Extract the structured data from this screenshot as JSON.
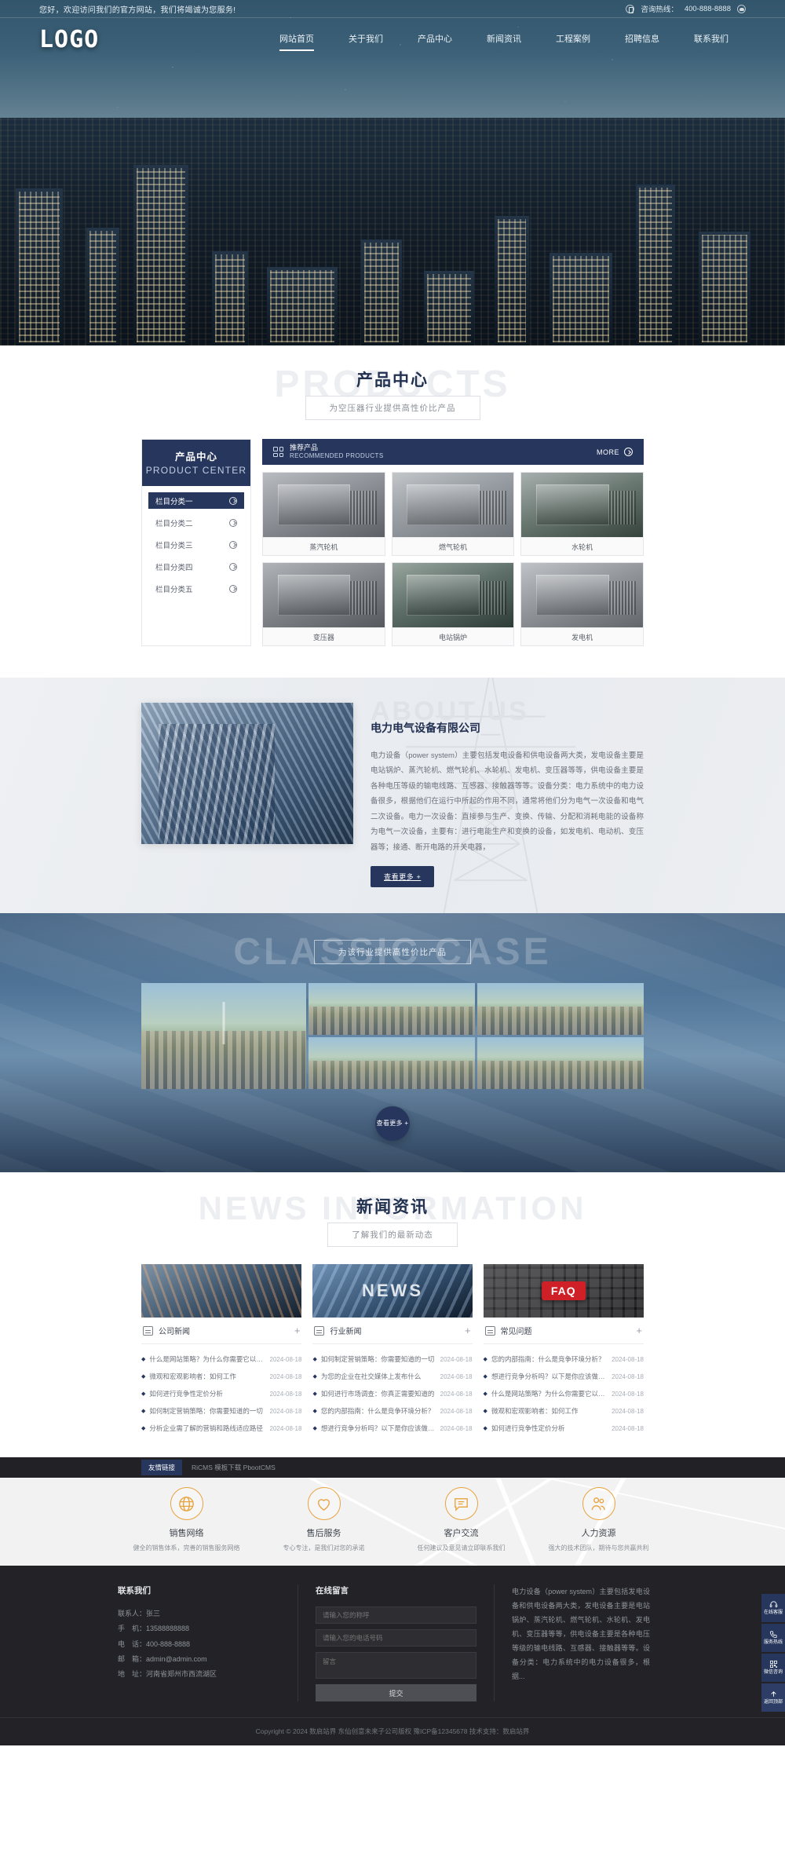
{
  "topbar": {
    "welcome": "您好，欢迎访问我们的官方网站，我们将竭诚为您服务!",
    "hotline_label": "咨询热线：",
    "hotline_number": "400-888-8888"
  },
  "header": {
    "logo": "LOGO",
    "nav": [
      {
        "label": "网站首页",
        "active": true
      },
      {
        "label": "关于我们",
        "active": false
      },
      {
        "label": "产品中心",
        "active": false
      },
      {
        "label": "新闻资讯",
        "active": false
      },
      {
        "label": "工程案例",
        "active": false
      },
      {
        "label": "招聘信息",
        "active": false
      },
      {
        "label": "联系我们",
        "active": false
      }
    ]
  },
  "products": {
    "ghost": "PRODUCTS",
    "title": "产品中心",
    "subtitle": "为空压器行业提供高性价比产品",
    "sidebar": {
      "title_cn": "产品中心",
      "title_en": "PRODUCT CENTER",
      "items": [
        {
          "label": "栏目分类一",
          "active": true
        },
        {
          "label": "栏目分类二",
          "active": false
        },
        {
          "label": "栏目分类三",
          "active": false
        },
        {
          "label": "栏目分类四",
          "active": false
        },
        {
          "label": "栏目分类五",
          "active": false
        }
      ]
    },
    "bar": {
      "title_cn": "推荐产品",
      "title_en": "RECOMMENDED PRODUCTS",
      "more": "MORE"
    },
    "items": [
      {
        "name": "蒸汽轮机"
      },
      {
        "name": "燃气轮机"
      },
      {
        "name": "水轮机"
      },
      {
        "name": "变压器"
      },
      {
        "name": "电站锅炉"
      },
      {
        "name": "发电机"
      }
    ]
  },
  "about": {
    "ghost": "ABOUT US",
    "heading": "电力电气设备有限公司",
    "body": "电力设备（power system）主要包括发电设备和供电设备两大类，发电设备主要是电站锅炉、蒸汽轮机、燃气轮机、水轮机、发电机、变压器等等，供电设备主要是各种电压等级的输电线路、互感器、接触器等等。设备分类：电力系统中的电力设备很多，根据他们在运行中所起的作用不同，通常将他们分为电气一次设备和电气二次设备。电力一次设备：直接参与生产、变换、传输、分配和消耗电能的设备称为电气一次设备，主要有：进行电能生产和变换的设备，如发电机、电动机、变压器等；接通、断开电路的开关电器，",
    "button": "查看更多 +"
  },
  "cases": {
    "ghost": "CLASSIC CASE",
    "title": "",
    "subtitle": "为该行业提供高性价比产品",
    "button": "查看更多 +"
  },
  "news": {
    "ghost": "NEWS INFORMATION",
    "title": "新闻资讯",
    "subtitle": "了解我们的最新动态",
    "columns": [
      {
        "label": "公司新闻",
        "image_word": "",
        "items": [
          {
            "title": "什么是网站策略？为什么你需要它以及你如...",
            "date": "2024-08-18"
          },
          {
            "title": "微观和宏观影响者：如何工作",
            "date": "2024-08-18"
          },
          {
            "title": "如何进行竞争性定价分析",
            "date": "2024-08-18"
          },
          {
            "title": "如何制定营销策略：你需要知道的一切",
            "date": "2024-08-18"
          },
          {
            "title": "分析企业需了解的营销和路线适应路径",
            "date": "2024-08-18"
          }
        ]
      },
      {
        "label": "行业新闻",
        "image_word": "NEWS",
        "items": [
          {
            "title": "如何制定营销策略：你需要知道的一切",
            "date": "2024-08-18"
          },
          {
            "title": "为您的企业在社交媒体上发布什么",
            "date": "2024-08-18"
          },
          {
            "title": "如何进行市场调查：你真正需要知道的",
            "date": "2024-08-18"
          },
          {
            "title": "您的内部指南：什么是竞争环境分析？",
            "date": "2024-08-18"
          },
          {
            "title": "想进行竞争分析吗？以下是你应该做的7个...",
            "date": "2024-08-18"
          }
        ]
      },
      {
        "label": "常见问题",
        "image_word": "FAQ",
        "items": [
          {
            "title": "您的内部指南：什么是竞争环境分析？",
            "date": "2024-08-18"
          },
          {
            "title": "想进行竞争分析吗？以下是你应该做的7个...",
            "date": "2024-08-18"
          },
          {
            "title": "什么是网站策略？为什么你需要它以及你如...",
            "date": "2024-08-18"
          },
          {
            "title": "微观和宏观影响者：如何工作",
            "date": "2024-08-18"
          },
          {
            "title": "如何进行竞争性定价分析",
            "date": "2024-08-18"
          }
        ]
      }
    ]
  },
  "linkbar": {
    "tag": "友情链接",
    "links": "RiCMS  模板下载  PbootCMS"
  },
  "service": [
    {
      "icon": "globe-icon",
      "title": "销售网络",
      "desc": "健全的销售体系，完善的销售服务网络"
    },
    {
      "icon": "heart-icon",
      "title": "售后服务",
      "desc": "专心专注，是我们对您的承诺"
    },
    {
      "icon": "chat-icon",
      "title": "客户交流",
      "desc": "任何建议及意见请立即联系我们"
    },
    {
      "icon": "people-icon",
      "title": "人力资源",
      "desc": "强大的技术团队，期待与您共赢共利"
    }
  ],
  "footer": {
    "contact": {
      "heading": "联系我们",
      "rows": [
        "联系人：张三",
        "手　机：13588888888",
        "电　话：400-888-8888",
        "邮　箱：admin@admin.com",
        "地　址：河南省郑州市西流湖区"
      ]
    },
    "message": {
      "heading": "在线留言",
      "name_placeholder": "请输入您的称呼",
      "phone_placeholder": "请输入您的电话号码",
      "msg_placeholder": "留言",
      "submit": "提交"
    },
    "about_text": "电力设备（power system）主要包括发电设备和供电设备两大类，发电设备主要是电站锅炉、蒸汽轮机、燃气轮机、水轮机、发电机、变压器等等，供电设备主要是各种电压等级的输电线路、互感器、接触器等等。设备分类：电力系统中的电力设备很多，根据...",
    "copyright": "Copyright © 2024 数启站界 东仙创意未来子公司版权 豫ICP备12345678 技术支持：数启站界"
  },
  "sidebtns": [
    {
      "icon": "headset-icon",
      "label": "在线客服"
    },
    {
      "icon": "phone-icon",
      "label": "服务热线"
    },
    {
      "icon": "qrcode-icon",
      "label": "微信咨询"
    },
    {
      "icon": "arrow-up-icon",
      "label": "返回顶部"
    }
  ],
  "colors": {
    "brand": "#26365c",
    "accent": "#e8a33d",
    "red": "#cf2027"
  }
}
